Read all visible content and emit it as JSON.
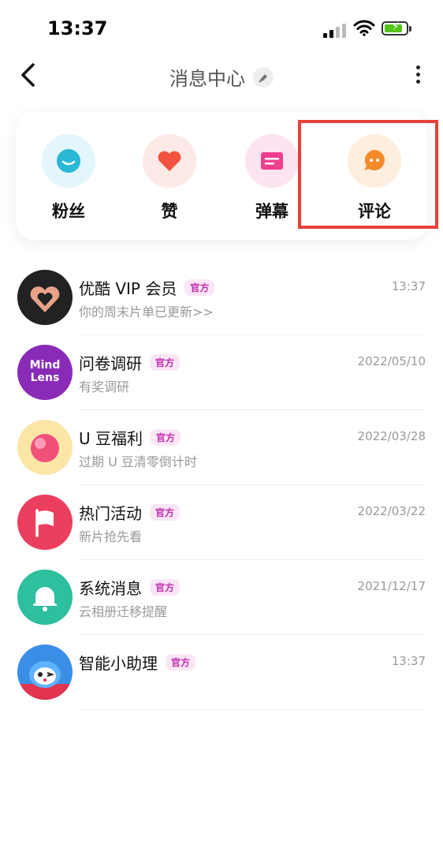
{
  "status": {
    "time": "13:37"
  },
  "nav": {
    "title": "消息中心"
  },
  "quick": [
    {
      "label": "粉丝",
      "icon": "smile-icon",
      "bg": "#e3f6fb",
      "fg": "#2bb8d6"
    },
    {
      "label": "赞",
      "icon": "heart-icon",
      "bg": "#fde9e6",
      "fg": "#f1533f"
    },
    {
      "label": "弹幕",
      "icon": "danmaku-icon",
      "bg": "#fde4f0",
      "fg": "#ee3f8f"
    },
    {
      "label": "评论",
      "icon": "comment-icon",
      "bg": "#fdeede",
      "fg": "#f58a2b"
    }
  ],
  "messages": [
    {
      "name": "优酷 VIP 会员",
      "badge": "官方",
      "sub": "你的周末片单已更新>>",
      "date": "13:37",
      "avatar": "youku-vip-avatar"
    },
    {
      "name": "问卷调研",
      "badge": "官方",
      "sub": "有奖调研",
      "date": "2022/05/10",
      "avatar": "mindlens-avatar",
      "avatar_text": "Mind Lens"
    },
    {
      "name": "U 豆福利",
      "badge": "官方",
      "sub": "过期 U 豆清零倒计时",
      "date": "2022/03/28",
      "avatar": "udou-avatar"
    },
    {
      "name": "热门活动",
      "badge": "官方",
      "sub": "新片抢先看",
      "date": "2022/03/22",
      "avatar": "flag-avatar"
    },
    {
      "name": "系统消息",
      "badge": "官方",
      "sub": "云相册迁移提醒",
      "date": "2021/12/17",
      "avatar": "bell-avatar"
    },
    {
      "name": "智能小助理",
      "badge": "官方",
      "sub": "",
      "date": "13:37",
      "avatar": "assistant-avatar"
    }
  ]
}
